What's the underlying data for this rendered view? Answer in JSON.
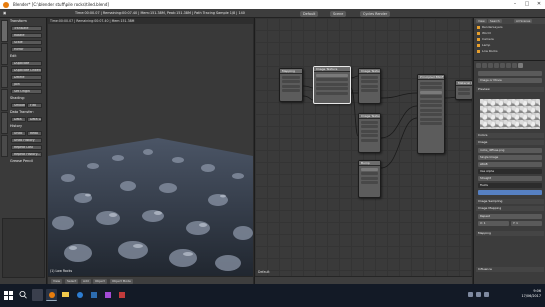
{
  "window": {
    "title": "Blender* [C:\\blender stuff\\pile rocks\\tiled.blend]"
  },
  "infobar": {
    "menus": [
      "File",
      "Render",
      "Window",
      "Help"
    ],
    "layout": "Default",
    "scene": "Scene",
    "engine": "Cycles Render",
    "stats": "Time:00:00.07 | Remaining:00:07.40 | Mem:151.38M, Peak:151.38M | Path Tracing Sample 1/8 | 140"
  },
  "toolshelf": {
    "section_transform": "Transform",
    "buttons_transform": [
      "Translate",
      "Rotate",
      "Scale",
      "Mirror"
    ],
    "section_edit": "Edit",
    "buttons_edit": [
      "Duplicate",
      "Duplicate Linked",
      "Delete",
      "Join"
    ],
    "set_origin": "Set Origin",
    "section_shading": "Shading:",
    "shading_buttons": [
      "Smooth",
      "Flat"
    ],
    "section_data_transfer": "Data Transfer:",
    "data_transfer_buttons": [
      "Data",
      "Data Layout"
    ],
    "section_history": "History",
    "history_buttons": [
      "Undo",
      "Redo",
      "Undo History",
      "Repeat Last",
      "Repeat History..."
    ],
    "section_grease": "Grease Pencil"
  },
  "viewport": {
    "stats": "Time:00:00.07 | Remaining:00:07.40 | Mem:151.38M",
    "object_label": "(1) Low Rocks",
    "footer_buttons": [
      "View",
      "Select",
      "Add",
      "Object",
      "Object Mode"
    ]
  },
  "node_editor": {
    "label": "Default",
    "nodes": [
      {
        "id": "n1",
        "title": "Mapping"
      },
      {
        "id": "n2",
        "title": "Image Texture"
      },
      {
        "id": "n3",
        "title": "Image Texture"
      },
      {
        "id": "n4",
        "title": "Image Texture"
      },
      {
        "id": "n5",
        "title": "Bump"
      },
      {
        "id": "n6",
        "title": "Principled BSDF"
      },
      {
        "id": "n7",
        "title": "Material Output"
      }
    ],
    "footer_buttons": [
      "View",
      "Select",
      "Add",
      "Node",
      "Use Nodes"
    ]
  },
  "outliner": {
    "header_buttons": [
      "View",
      "Search",
      "All Scenes"
    ],
    "rows": [
      "RenderLayers",
      "World",
      "Camera",
      "Lamp",
      "Low Rocks"
    ]
  },
  "properties": {
    "sections": {
      "preview": "Preview",
      "colors": "Colors",
      "image": "Image",
      "image_sampling": "Image Sampling",
      "image_mapping": "Image Mapping",
      "mapping": "Mapping",
      "influence": "Influence"
    },
    "fields": {
      "texture_type": "Image or Movie",
      "image_name": "rocks_diffuse.png",
      "source": "Single Image",
      "color_space": "sRGB",
      "alpha": "Use Alpha",
      "alpha_mode": "Straight",
      "fields": "Fields",
      "extension": "Repeat",
      "repeat_x": "X: 1",
      "repeat_y": "Y: 1"
    }
  },
  "taskbar": {
    "time": "9:06",
    "date": "17/06/2017"
  },
  "colors": {
    "accent": "#e87d0d",
    "select_blue": "#5680c2"
  }
}
